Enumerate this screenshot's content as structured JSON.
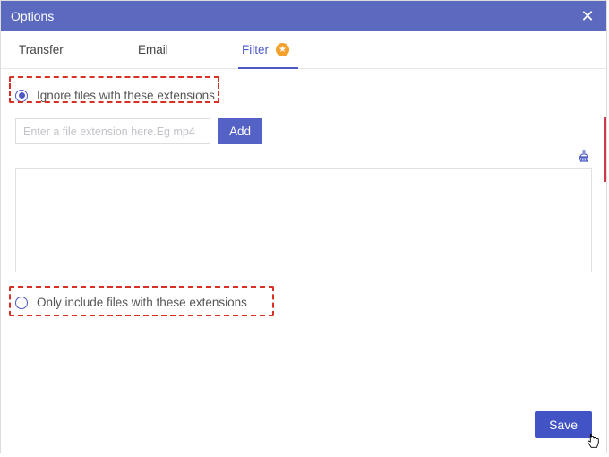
{
  "header": {
    "title": "Options"
  },
  "tabs": {
    "transfer": "Transfer",
    "email": "Email",
    "filter": "Filter"
  },
  "filter": {
    "ignore_label": "Ignore files with these extensions",
    "include_label": "Only include files with these extensions",
    "ext_placeholder": "Enter a file extension here.Eg mp4",
    "add_label": "Add"
  },
  "footer": {
    "save_label": "Save"
  }
}
